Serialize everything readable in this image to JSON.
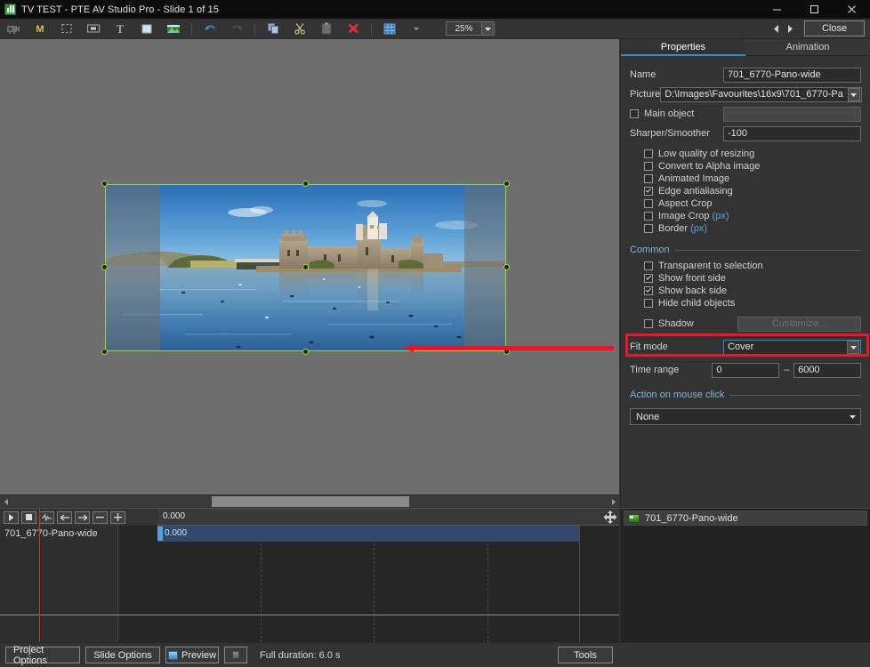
{
  "window": {
    "title": "TV TEST - PTE AV Studio Pro - Slide 1 of 15",
    "app_icon": "app-logo-icon",
    "minimize": "minimize-icon",
    "maximize": "maximize-icon",
    "close": "close-icon"
  },
  "toolbar": {
    "items": [
      {
        "name": "projector-icon",
        "glyph": "■"
      },
      {
        "name": "main-object-m-icon",
        "glyph": "M"
      },
      {
        "name": "marquee-select-icon",
        "glyph": "⬚"
      },
      {
        "name": "mask-icon",
        "glyph": "▣"
      },
      {
        "name": "add-text-icon",
        "glyph": "T"
      },
      {
        "name": "add-rectangle-icon",
        "glyph": "■"
      },
      {
        "name": "add-image-icon",
        "glyph": "⛰"
      },
      {
        "name": "undo-icon",
        "glyph": "↶"
      },
      {
        "name": "redo-icon",
        "glyph": "↷"
      },
      {
        "name": "copy-icon",
        "glyph": "⧉"
      },
      {
        "name": "cut-icon",
        "glyph": "✂"
      },
      {
        "name": "paste-icon",
        "glyph": "▤"
      },
      {
        "name": "delete-icon",
        "glyph": "✕"
      },
      {
        "name": "grid-icon",
        "glyph": "▦"
      },
      {
        "name": "grid-dropdown-icon",
        "glyph": "▼"
      }
    ],
    "zoom_value": "25%",
    "zoom_dropdown_icon": "chevron-down-icon",
    "prev_slide_icon": "◀",
    "next_slide_icon": "▶",
    "close_label": "Close"
  },
  "canvas": {
    "object_name": "701_6770-Pano-wide",
    "selection_color": "#9bd44b",
    "annotation_color": "#e8192c",
    "annotation": "red-arrow-pointing-left"
  },
  "properties": {
    "tabs": [
      {
        "label": "Properties",
        "active": true
      },
      {
        "label": "Animation",
        "active": false
      }
    ],
    "fields": {
      "name_label": "Name",
      "name_value": "701_6770-Pano-wide",
      "picture_label": "Picture",
      "picture_value": "D:\\Images\\Favourites\\16x9\\701_6770-Pa",
      "main_object_label": "Main object",
      "main_object_checked": false,
      "sharper_label": "Sharper/Smoother",
      "sharper_value": "-100"
    },
    "image_options": [
      {
        "label": "Low quality of resizing",
        "checked": false
      },
      {
        "label": "Convert to Alpha image",
        "checked": false
      },
      {
        "label": "Animated Image",
        "checked": false
      },
      {
        "label": "Edge antialiasing",
        "checked": true
      },
      {
        "label": "Aspect Crop",
        "checked": false
      },
      {
        "label": "Image Crop",
        "suffix": "(px)",
        "checked": false
      },
      {
        "label": "Border",
        "suffix": "(px)",
        "checked": false
      }
    ],
    "common_header": "Common",
    "common_options": [
      {
        "label": "Transparent to selection",
        "checked": false
      },
      {
        "label": "Show front side",
        "checked": true
      },
      {
        "label": "Show back side",
        "checked": true
      },
      {
        "label": "Hide child objects",
        "checked": false
      }
    ],
    "shadow_label": "Shadow",
    "shadow_checked": false,
    "customize_label": "Customize...",
    "fit_mode_label": "Fit mode",
    "fit_mode_value": "Cover",
    "fit_mode_arrow_icon": "chevron-down-icon",
    "time_range_label": "Time range",
    "time_range_start": "0",
    "time_range_dash": "–",
    "time_range_end": "6000",
    "action_header": "Action on mouse click",
    "action_value": "None",
    "action_arrow_icon": "chevron-down-icon"
  },
  "objects_panel": {
    "rows": [
      {
        "icon": "image-thumbnail-icon",
        "name": "701_6770-Pano-wide"
      }
    ]
  },
  "timeline": {
    "buttons": [
      {
        "name": "play-button",
        "glyph": "▶"
      },
      {
        "name": "stop-button",
        "glyph": "■"
      },
      {
        "name": "waveform-button",
        "glyph": "〰"
      },
      {
        "name": "prev-keyframe-button",
        "glyph": "←"
      },
      {
        "name": "next-keyframe-button",
        "glyph": "→"
      },
      {
        "name": "zoom-out-button",
        "glyph": "−"
      },
      {
        "name": "zoom-in-button",
        "glyph": "+"
      }
    ],
    "ruler_value": "0.000",
    "drag_icon": "move-resize-icon",
    "track_name": "701_6770-Pano-wide",
    "clip_label": "0.000"
  },
  "statusbar": {
    "project_options": "Project Options",
    "slide_options": "Slide Options",
    "preview": "Preview",
    "preview_icon": "preview-screen-icon",
    "fullscreen_icon": "fullscreen-preview-icon",
    "duration": "Full duration: 6.0 s",
    "tools": "Tools"
  }
}
